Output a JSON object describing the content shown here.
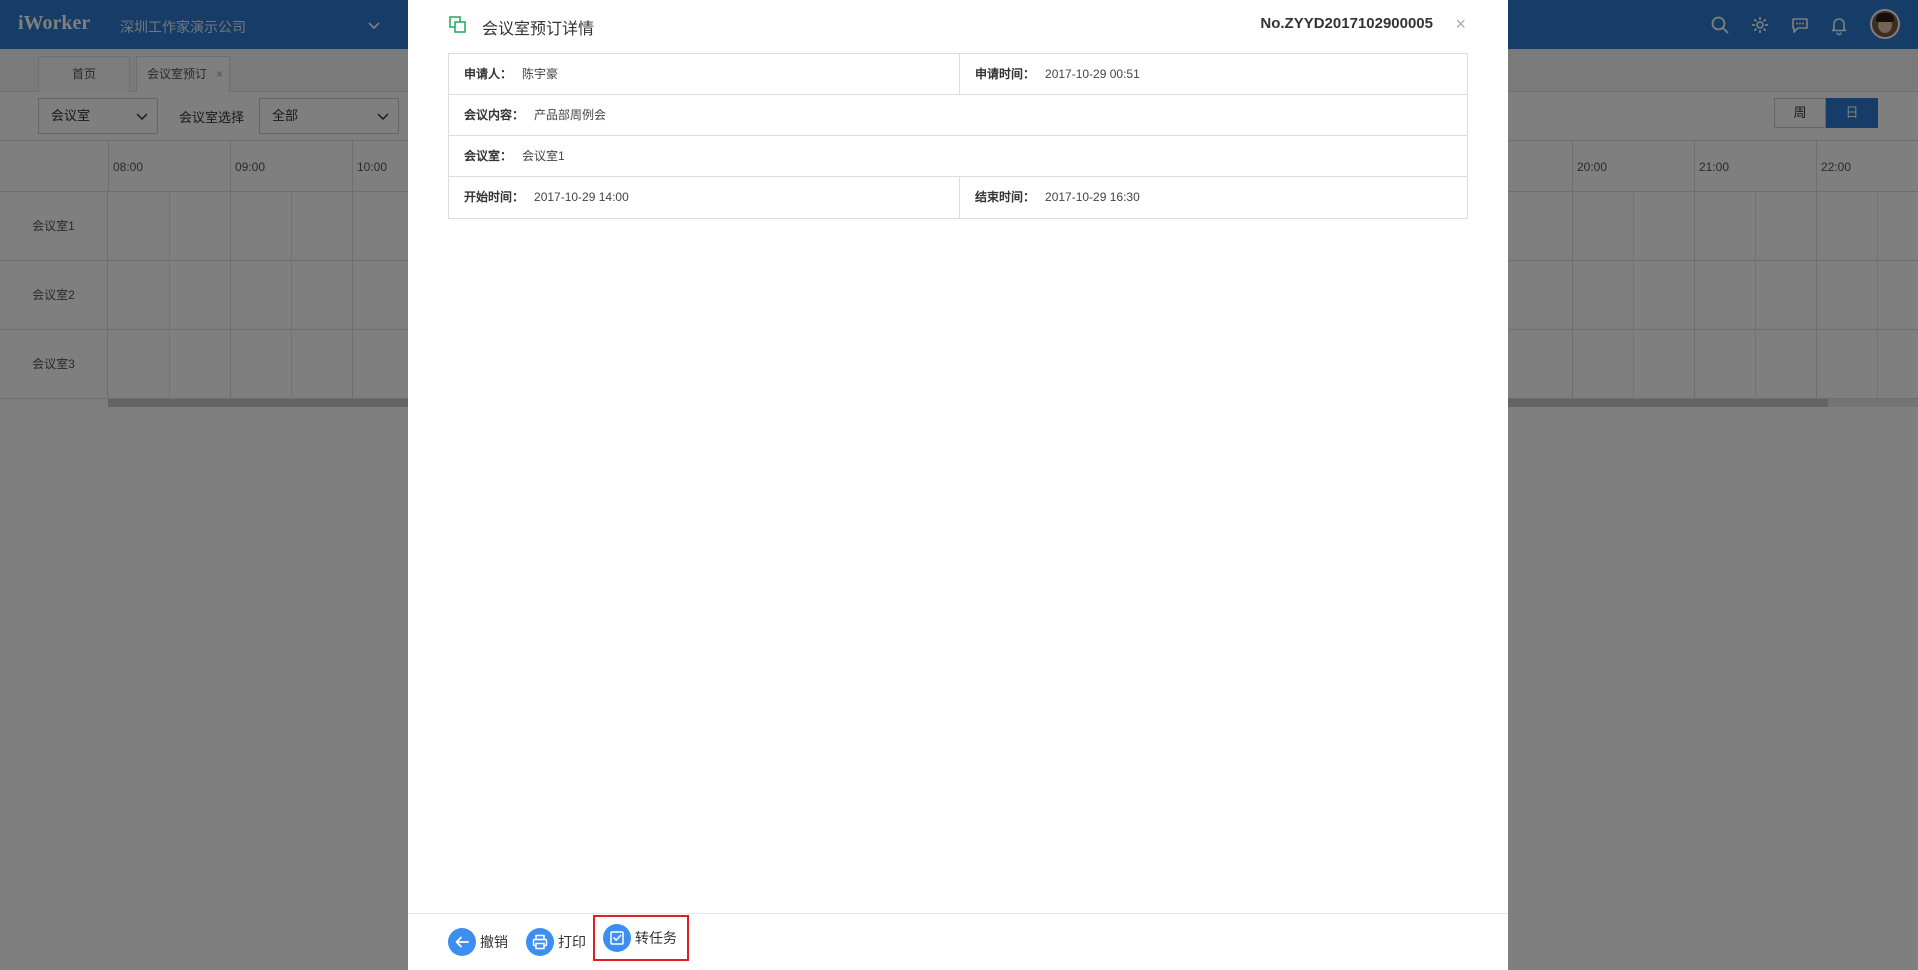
{
  "app": {
    "logo": "iWorker",
    "company": "深圳工作家演示公司"
  },
  "tabs": [
    {
      "label": "首页"
    },
    {
      "label": "会议室预订",
      "close": "×"
    }
  ],
  "filters": {
    "type_select": "会议室",
    "room_label": "会议室选择",
    "room_select": "全部",
    "view_week": "周",
    "view_day": "日"
  },
  "timeline": {
    "left_hours": [
      "08:00",
      "09:00",
      "10:00"
    ],
    "right_hours": [
      "20:00",
      "21:00",
      "22:00"
    ],
    "rooms": [
      "会议室1",
      "会议室2",
      "会议室3"
    ]
  },
  "modal": {
    "title": "会议室预订详情",
    "number": "No.ZYYD2017102900005",
    "close": "×",
    "applicant_label": "申请人：",
    "applicant": "陈宇豪",
    "apply_time_label": "申请时间：",
    "apply_time": "2017-10-29 00:51",
    "content_label": "会议内容：",
    "content": "产品部周例会",
    "room_label": "会议室：",
    "room": "会议室1",
    "start_label": "开始时间：",
    "start": "2017-10-29 14:00",
    "end_label": "结束时间：",
    "end": "2017-10-29 16:30"
  },
  "footer": {
    "revoke": "撤销",
    "print": "打印",
    "to_task": "转任务"
  },
  "colors": {
    "primary": "#2a7ad1",
    "icon_blue": "#3c8ff0",
    "highlight": "#e02020",
    "green": "#27ae60"
  }
}
